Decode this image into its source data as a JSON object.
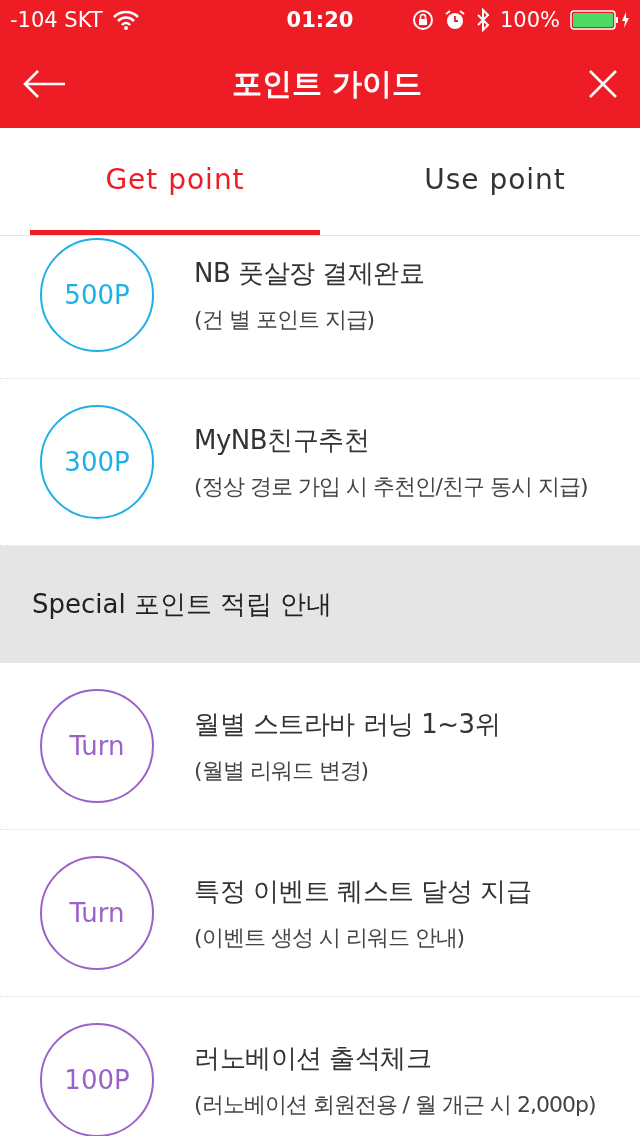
{
  "status_bar": {
    "carrier": "-104 SKT",
    "time": "01:20",
    "battery": "100%"
  },
  "header": {
    "title": "포인트 가이드"
  },
  "tabs": [
    {
      "label": "Get point",
      "selected": true
    },
    {
      "label": "Use point",
      "selected": false
    }
  ],
  "list": [
    {
      "kind": "item",
      "badge": "500P",
      "title": "NB 풋살장 결제완료",
      "subtitle": "(건 별 포인트 지급)",
      "color": "#1fb0e6"
    },
    {
      "kind": "item",
      "badge": "300P",
      "title": "MyNB친구추천",
      "subtitle": "(정상 경로 가입 시 추천인/친구 동시 지급)",
      "color": "#1fb0e6"
    },
    {
      "kind": "section",
      "title": "Special 포인트 적립 안내"
    },
    {
      "kind": "item",
      "badge": "Turn",
      "title": "월별 스트라바 러닝 1~3위",
      "subtitle": "(월별 리워드 변경)",
      "color": "#9b63c9"
    },
    {
      "kind": "item",
      "badge": "Turn",
      "title": "특정 이벤트 퀘스트 달성 지급",
      "subtitle": "(이벤트 생성 시 리워드 안내)",
      "color": "#9b63c9"
    },
    {
      "kind": "item",
      "badge": "100P",
      "title": "러노베이션 출석체크",
      "subtitle": "(러노베이션 회원전용 / 월 개근 시 2,000p)",
      "color": "#9b63c9"
    }
  ]
}
